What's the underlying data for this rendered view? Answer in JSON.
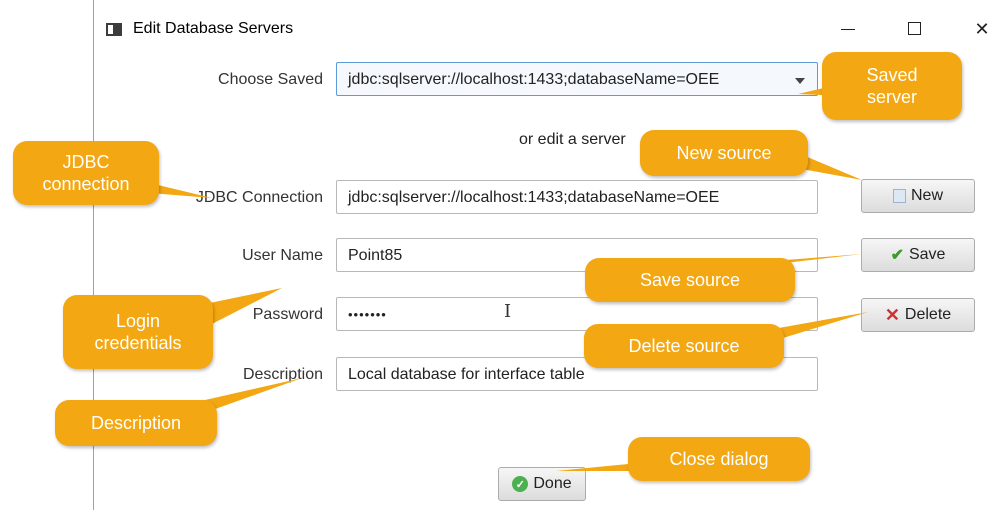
{
  "window": {
    "title": "Edit Database Servers",
    "minimize_glyph": "—",
    "maximize_glyph": "☐",
    "close_glyph": "✕"
  },
  "form": {
    "choose_saved_label": "Choose Saved",
    "choose_saved_value": "jdbc:sqlserver://localhost:1433;databaseName=OEE",
    "or_edit_text": "or edit a server",
    "jdbc_label": "JDBC Connection",
    "jdbc_value": "jdbc:sqlserver://localhost:1433;databaseName=OEE",
    "user_label": "User Name",
    "user_value": "Point85",
    "password_label": "Password",
    "password_value": "•••••••",
    "description_label": "Description",
    "description_value": "Local database for interface table"
  },
  "buttons": {
    "new": "New",
    "save": "Save",
    "delete": "Delete",
    "done": "Done"
  },
  "callouts": {
    "saved_server": "Saved\nserver",
    "jdbc_connection": "JDBC\nconnection",
    "new_source": "New source",
    "save_source": "Save source",
    "login_credentials": "Login\ncredentials",
    "delete_source": "Delete source",
    "description": "Description",
    "close_dialog": "Close dialog"
  },
  "colors": {
    "callout": "#f3a712",
    "combo_border": "#5c9bd5",
    "window_border": "#8fb56a"
  },
  "icons": {
    "new": "document-icon",
    "save": "checkmark-icon",
    "delete": "x-icon",
    "done": "ok-circle-icon"
  }
}
